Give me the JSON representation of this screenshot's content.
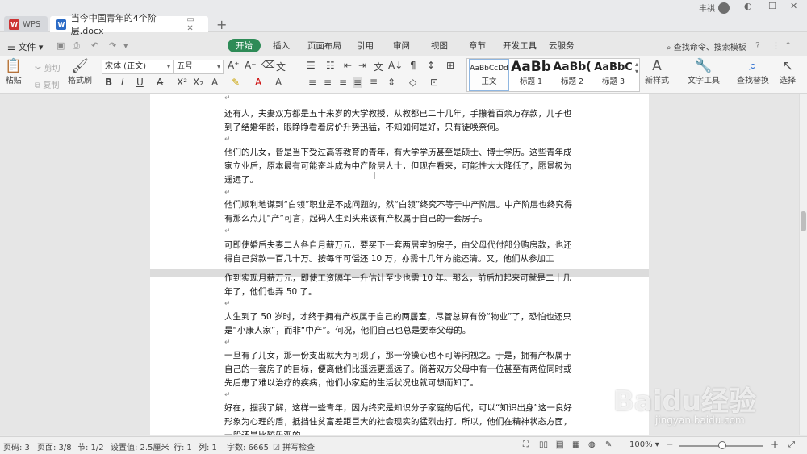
{
  "titlebar": {
    "app_tab": "WPS",
    "doc_tab": "当今中国青年的4个阶层.docx",
    "user_name": "丰祺"
  },
  "menu": {
    "file": "文件",
    "tabs": [
      "开始",
      "插入",
      "页面布局",
      "引用",
      "审阅",
      "视图",
      "章节",
      "开发工具",
      "云服务"
    ],
    "active_tab": "开始",
    "search": "查找命令、搜索模板"
  },
  "ribbon": {
    "paste": "粘贴",
    "cut": "剪切",
    "copy": "复制",
    "format_painter": "格式刷",
    "font_name": "宋体 (正文)",
    "font_size": "五号",
    "styles": [
      {
        "preview": "AaBbCcDd",
        "label": "正文"
      },
      {
        "preview": "AaBb",
        "label": "标题 1"
      },
      {
        "preview": "AaBb(",
        "label": "标题 2"
      },
      {
        "preview": "AaBbC",
        "label": "标题 3"
      }
    ],
    "new_style": "新样式",
    "text_tools": "文字工具",
    "find_replace": "查找替换",
    "select": "选择"
  },
  "document": {
    "paragraphs": [
      "还有人，夫妻双方都是五十来岁的大学教授，从教都已二十几年，手攥着百余万存款，儿子也到了结婚年龄，眼睁睁看着房价升势迅猛，不知如何是好，只有徒唤奈何。",
      "他们的儿女，皆是当下受过高等教育的青年，有大学学历甚至是硕士、博士学历。这些青年成家立业后，原本最有可能奋斗成为中产阶层人士，但现在看来，可能性大大降低了，愿景极为遥远了。",
      "他们顺利地谋到“白领”职业是不成问题的，然“白领”终究不等于中产阶层。中产阶层也终究得有那么点儿“产”可言，起码人生到头来该有产权属于自己的一套房子。",
      "可即使婚后夫妻二人各自月薪万元，要买下一套两居室的房子，由父母代付部分购房款，也还得自己贷款一百几十万。按每年可偿还 10 万，亦需十几年方能还清。又，他们从参加工",
      "作到实现月薪万元，即使工资隔年一升估计至少也需 10 年。那么，前后加起来可就是二十几年了，他们也弄 50 了。",
      "人生到了 50 岁时，才终于拥有产权属于自己的两居室，尽管总算有份“物业”了，恐怕也还只是“小康人家”，而非“中产”。何况，他们自己也总是要奉父母的。",
      "一旦有了儿女，那一份支出就大为可观了，那一份操心也不可等闲视之。于是，拥有产权属于自己的一套房子的目标，便离他们比遥远更遥远了。倘若双方父母中有一位甚至有两位同时或先后患了难以治疗的疾病，他们小家庭的生活状况也就可想而知了。",
      "好在，据我了解，这样一些青年，因为终究是知识分子家庭的后代，可以“知识出身”这一良好形象为心理的盾，抵挡住贫富差距巨大的社会现实的猛烈击打。所以，他们在精神状态方面，一般还是比较乐观的。"
    ]
  },
  "watermark": {
    "main": "Baidu经验",
    "sub": "jingyan.baidu.com"
  },
  "status": {
    "page_num": "页码: 3",
    "pages": "页面: 3/8",
    "section": "节: 1/2",
    "setting": "设置值: 2.5厘米",
    "row": "行: 1",
    "col": "列: 1",
    "words": "字数: 6665",
    "spell": "拼写检查",
    "zoom": "100%"
  }
}
